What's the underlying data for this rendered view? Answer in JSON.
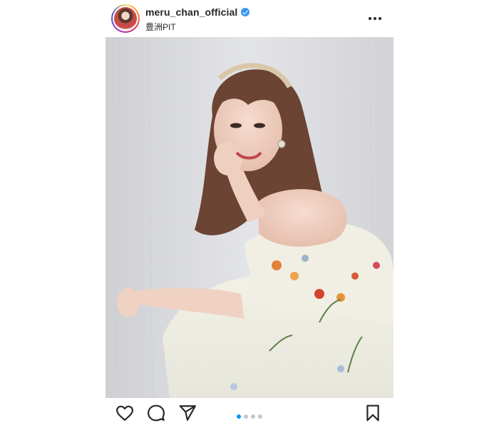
{
  "post": {
    "username": "meru_chan_official",
    "verified": true,
    "location": "豊洲PIT",
    "more_icon": "more-horizontal-icon",
    "photo_alt": "meru_chan_official post photo",
    "carousel": {
      "total": 4,
      "active_index": 0,
      "active_color": "#0095f6",
      "inactive_color": "#c7c7c7"
    },
    "actions": {
      "like_icon": "heart-icon",
      "comment_icon": "comment-icon",
      "share_icon": "share-icon",
      "save_icon": "bookmark-icon"
    },
    "colors": {
      "verified_badge": "#3897f0",
      "text": "#262626"
    }
  }
}
